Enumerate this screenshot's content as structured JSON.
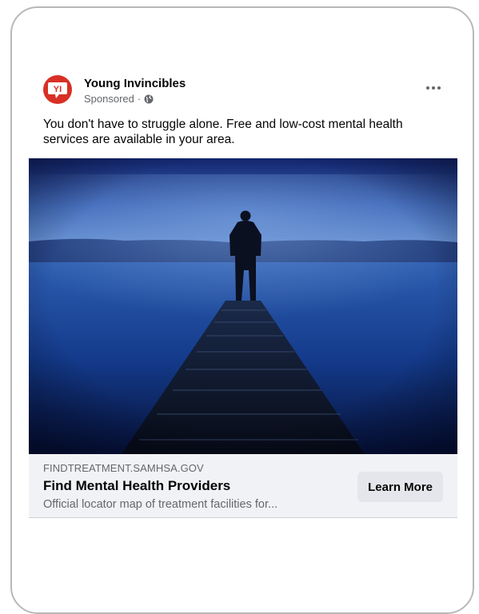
{
  "post": {
    "page_name": "Young Invincibles",
    "sponsored_label": "Sponsored",
    "separator": "·",
    "logo_text": "YI",
    "body_text": "You don't have to struggle alone. Free and low-cost mental health services are available in your area."
  },
  "link_preview": {
    "domain": "FINDTREATMENT.SAMHSA.GOV",
    "headline": "Find Mental Health Providers",
    "description": "Official locator map of treatment facilities for...",
    "cta_label": "Learn More"
  },
  "icons": {
    "logo": "young-invincibles-logo-icon",
    "privacy": "globe-icon",
    "more": "more-options-icon"
  },
  "colors": {
    "brand_red": "#d93025",
    "link_box_bg": "#f0f2f5",
    "cta_bg": "#e4e6eb",
    "text_primary": "#050505",
    "text_secondary": "#65676b"
  }
}
